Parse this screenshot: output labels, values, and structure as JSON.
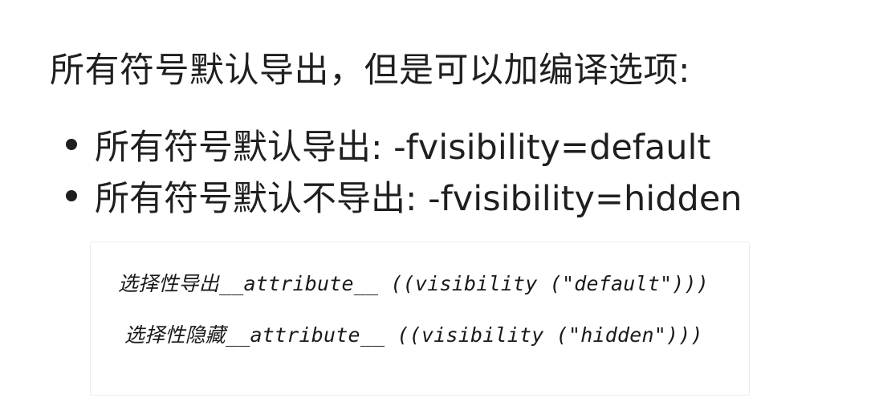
{
  "heading": "所有符号默认导出，但是可以加编译选项:",
  "bullets": [
    "所有符号默认导出: -fvisibility=default",
    "所有符号默认不导出: -fvisibility=hidden"
  ],
  "code": {
    "lines": [
      "选择性导出__attribute__ ((visibility (\"default\")))",
      "选择性隐藏__attribute__ ((visibility (\"hidden\")))"
    ]
  }
}
